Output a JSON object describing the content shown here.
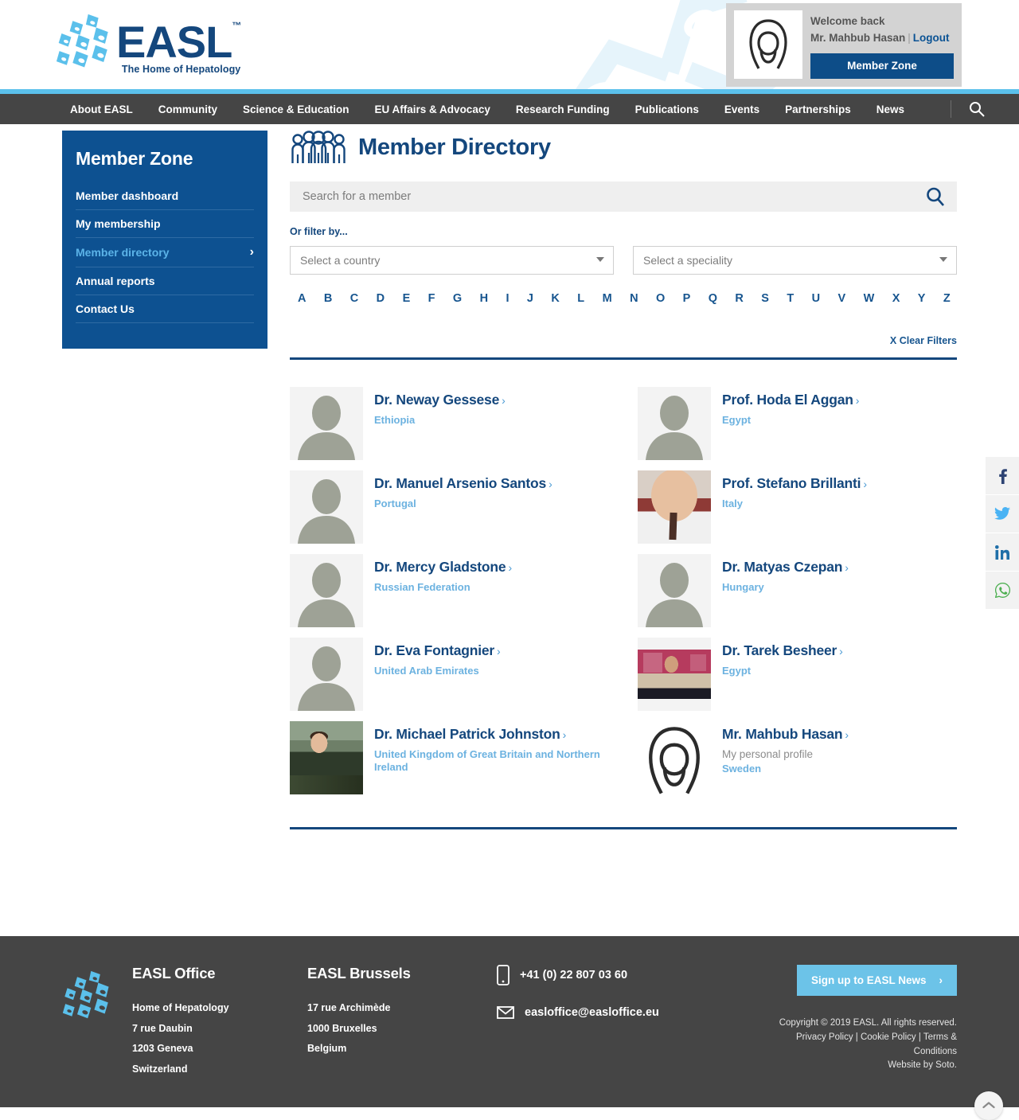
{
  "brand": {
    "name": "EASL",
    "trademark": "™",
    "tagline": "The Home of Hepatology"
  },
  "user_panel": {
    "welcome": "Welcome back",
    "name": "Mr. Mahbub Hasan",
    "separator": "|",
    "logout": "Logout",
    "member_zone_button": "Member Zone",
    "avatar_icon": "person-avatar-icon"
  },
  "nav": {
    "items": [
      "About EASL",
      "Community",
      "Science & Education",
      "EU Affairs & Advocacy",
      "Research Funding",
      "Publications",
      "Events",
      "Partnerships",
      "News"
    ],
    "search_icon": "search-icon"
  },
  "sidebar": {
    "title": "Member Zone",
    "items": [
      {
        "label": "Member dashboard",
        "active": false
      },
      {
        "label": "My membership",
        "active": false
      },
      {
        "label": "Member directory",
        "active": true
      },
      {
        "label": "Annual reports",
        "active": false
      },
      {
        "label": "Contact Us",
        "active": false
      }
    ],
    "active_chevron": "›"
  },
  "main": {
    "title": "Member Directory",
    "title_icon": "group-of-people-icon",
    "search": {
      "placeholder": "Search for a member",
      "value": "",
      "icon": "search-icon"
    },
    "filter_label": "Or filter by...",
    "country_select": {
      "value": "Select a country"
    },
    "speciality_select": {
      "value": "Select a speciality"
    },
    "alphabet": [
      "A",
      "B",
      "C",
      "D",
      "E",
      "F",
      "G",
      "H",
      "I",
      "J",
      "K",
      "L",
      "M",
      "N",
      "O",
      "P",
      "Q",
      "R",
      "S",
      "T",
      "U",
      "V",
      "W",
      "X",
      "Y",
      "Z"
    ],
    "clear_filters": "X Clear Filters"
  },
  "members": [
    {
      "name": "Dr. Neway Gessese",
      "chevron": "›",
      "country": "Ethiopia",
      "note": "",
      "avatar": "silhouette"
    },
    {
      "name": "Prof. Hoda El Aggan",
      "chevron": "›",
      "country": "Egypt",
      "note": "",
      "avatar": "silhouette"
    },
    {
      "name": "Dr. Manuel Arsenio Santos",
      "chevron": "›",
      "country": "Portugal",
      "note": "",
      "avatar": "silhouette"
    },
    {
      "name": "Prof. Stefano Brillanti",
      "chevron": "›",
      "country": "Italy",
      "note": "",
      "avatar": "photo-brillanti"
    },
    {
      "name": "Dr. Mercy Gladstone",
      "chevron": "›",
      "country": "Russian Federation",
      "note": "",
      "avatar": "silhouette"
    },
    {
      "name": "Dr. Matyas Czepan",
      "chevron": "›",
      "country": "Hungary",
      "note": "",
      "avatar": "silhouette"
    },
    {
      "name": "Dr. Eva Fontagnier",
      "chevron": "›",
      "country": "United Arab Emirates",
      "note": "",
      "avatar": "silhouette"
    },
    {
      "name": "Dr. Tarek Besheer",
      "chevron": "›",
      "country": "Egypt",
      "note": "",
      "avatar": "photo-besheer"
    },
    {
      "name": "Dr. Michael Patrick Johnston",
      "chevron": "›",
      "country": "United Kingdom of Great Britain and Northern Ireland",
      "note": "",
      "avatar": "photo-johnston"
    },
    {
      "name": "Mr. Mahbub Hasan",
      "chevron": "›",
      "country": "Sweden",
      "note": "My personal profile",
      "avatar": "line-avatar"
    }
  ],
  "social": [
    {
      "name": "facebook-icon",
      "glyph": "f",
      "color": "#2d4373"
    },
    {
      "name": "twitter-icon",
      "glyph": "t",
      "color": "#4ab3f4"
    },
    {
      "name": "linkedin-icon",
      "glyph": "in",
      "color": "#1f6fa8"
    },
    {
      "name": "whatsapp-icon",
      "glyph": "w",
      "color": "#4caf50"
    }
  ],
  "footer": {
    "office": {
      "heading": "EASL Office",
      "lines": [
        "Home of Hepatology",
        "7 rue Daubin",
        "1203 Geneva",
        "Switzerland"
      ]
    },
    "brussels": {
      "heading": "EASL Brussels",
      "lines": [
        "17 rue Archimède",
        "1000 Bruxelles",
        "Belgium"
      ]
    },
    "phone": "+41 (0) 22 807 03 60",
    "phone_icon": "mobile-phone-icon",
    "email": "easloffice@easloffice.eu",
    "email_icon": "envelope-icon",
    "signup_button": "Sign up to EASL News",
    "signup_chevron": "›",
    "copyright": "Copyright © 2019 EASL. All rights reserved.",
    "privacy": "Privacy Policy",
    "cookie": "Cookie Policy",
    "terms": "Terms & Conditions",
    "website_by": "Website by Soto.",
    "legal_sep": " | ",
    "to_top_icon": "chevron-up-icon"
  }
}
